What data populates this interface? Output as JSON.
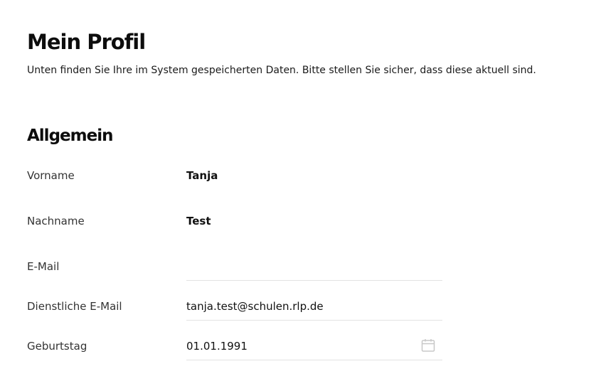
{
  "header": {
    "title": "Mein Profil",
    "subtitle": "Unten finden Sie Ihre im System gespeicherten Daten. Bitte stellen Sie sicher, dass diese aktuell sind."
  },
  "section": {
    "title": "Allgemein"
  },
  "fields": {
    "vorname": {
      "label": "Vorname",
      "value": "Tanja"
    },
    "nachname": {
      "label": "Nachname",
      "value": "Test"
    },
    "email": {
      "label": "E-Mail",
      "value": ""
    },
    "dienst_email": {
      "label": "Dienstliche E-Mail",
      "value": "tanja.test@schulen.rlp.de"
    },
    "geburtstag": {
      "label": "Geburtstag",
      "value": "01.01.1991",
      "icon": "calendar-icon"
    }
  },
  "colors": {
    "text": "#111111",
    "label": "#333333",
    "divider": "#e2e2e2",
    "icon": "#c8c8c8"
  }
}
